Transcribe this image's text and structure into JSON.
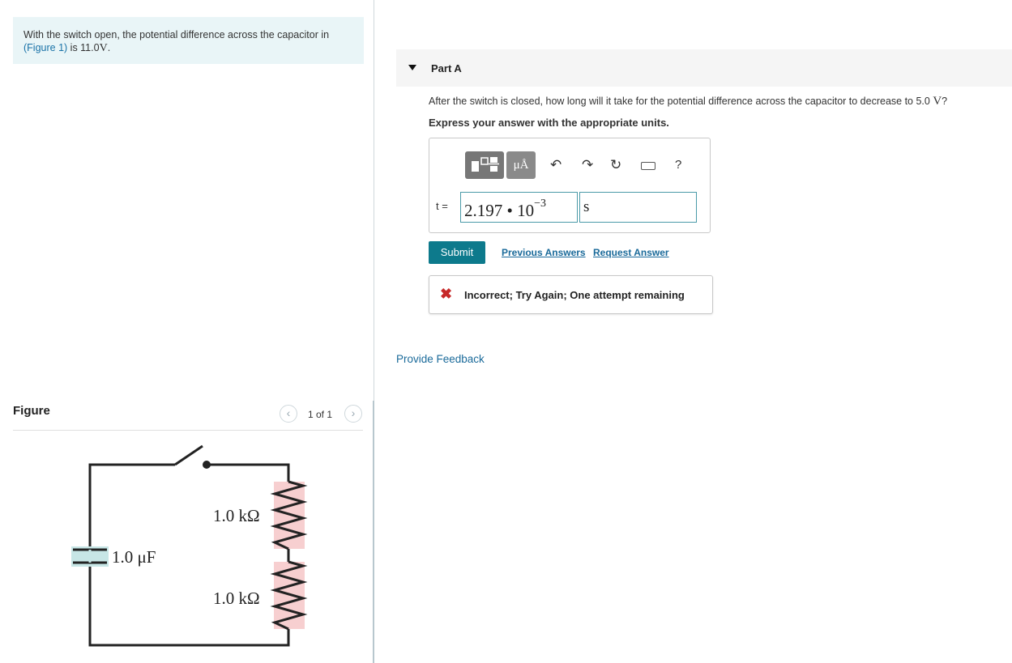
{
  "intro": {
    "text_before": "With the switch open, the potential difference across the capacitor in",
    "figure_link": "(Figure 1)",
    "text_mid": " is 11.0",
    "unit": "V",
    "text_after": "."
  },
  "figure": {
    "title": "Figure",
    "pager": "1 of 1",
    "resistor_top_label": "1.0 kΩ",
    "resistor_bottom_label": "1.0 kΩ",
    "capacitor_label": "1.0 μF"
  },
  "part": {
    "title": "Part A",
    "question_text": "After the switch is closed, how long will it take for the potential difference across the capacitor to decrease to 5.0 ",
    "question_unit": "V",
    "question_end": "?",
    "instruction": "Express your answer with the appropriate units."
  },
  "toolbar": {
    "units_button": "μÅ",
    "help": "?"
  },
  "answer": {
    "variable_label": "t =",
    "value_mantissa": "2.197 • 10",
    "value_exponent": "−3",
    "unit_value": "s"
  },
  "actions": {
    "submit": "Submit",
    "previous_answers": "Previous Answers",
    "request_answer": "Request Answer"
  },
  "result": {
    "message": "Incorrect; Try Again; One attempt remaining",
    "status_color": "#c62828"
  },
  "provide_feedback": "Provide Feedback"
}
